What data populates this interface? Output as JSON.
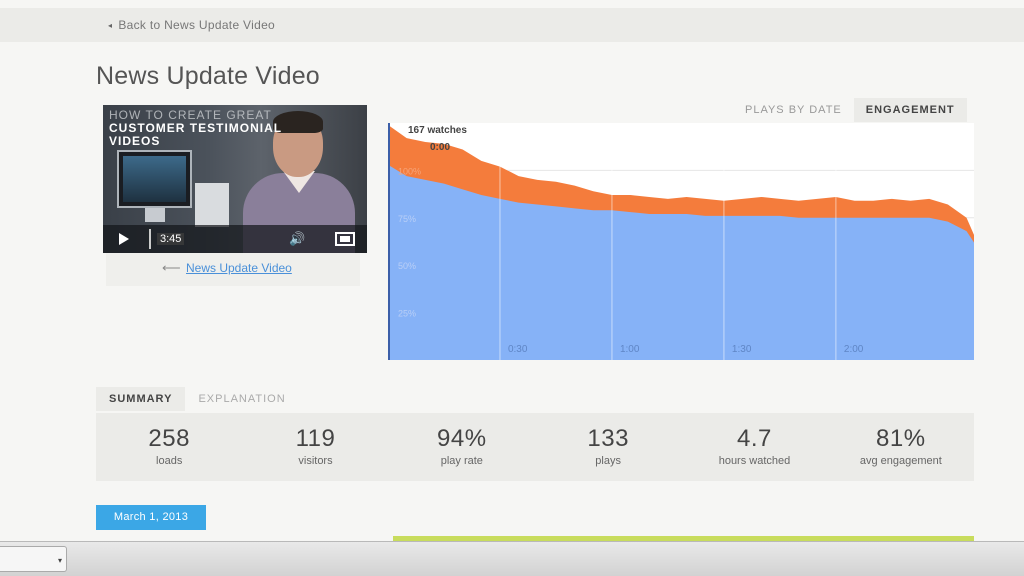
{
  "nav": {
    "back_label": "Back to News Update Video"
  },
  "page": {
    "title": "News Update Video"
  },
  "video": {
    "overlay_lines": [
      "How to create great",
      "Customer testimonial",
      "videos"
    ],
    "time": "3:45",
    "caption_link": "News Update Video"
  },
  "chart_tabs": [
    {
      "label": "PLAYS BY DATE",
      "active": false
    },
    {
      "label": "ENGAGEMENT",
      "active": true
    }
  ],
  "chart_data": {
    "type": "area",
    "title": "",
    "watches_label": "167 watches",
    "cursor_time": "0:00",
    "x_ticks": [
      "0:30",
      "1:00",
      "1:30",
      "2:00"
    ],
    "y_ticks": [
      "100%",
      "75%",
      "50%",
      "25%"
    ],
    "xlim": [
      0,
      157
    ],
    "ylim": [
      0,
      125
    ],
    "series": [
      {
        "x": [
          0,
          5,
          10,
          15,
          20,
          25,
          30,
          35,
          40,
          45,
          50,
          55,
          60,
          65,
          70,
          75,
          80,
          85,
          90,
          95,
          100,
          105,
          110,
          115,
          120,
          125,
          130,
          135,
          140,
          145,
          150,
          155,
          157
        ],
        "values": [
          124,
          117,
          115,
          114,
          111,
          105,
          102,
          97,
          95,
          94,
          92,
          89,
          87,
          87,
          86,
          85,
          86,
          85,
          84,
          85,
          86,
          85,
          84,
          85,
          86,
          84,
          84,
          85,
          84,
          85,
          82,
          75,
          66
        ],
        "color": "#f47c3c"
      },
      {
        "x": [
          0,
          5,
          10,
          15,
          20,
          25,
          30,
          35,
          40,
          45,
          50,
          55,
          60,
          65,
          70,
          75,
          80,
          85,
          90,
          95,
          100,
          105,
          110,
          115,
          120,
          125,
          130,
          135,
          140,
          145,
          150,
          155,
          157
        ],
        "values": [
          103,
          97,
          95,
          93,
          90,
          87,
          85,
          83,
          82,
          81,
          80,
          79,
          79,
          78,
          77,
          77,
          77,
          76,
          76,
          76,
          76,
          76,
          75,
          75,
          75,
          75,
          75,
          75,
          75,
          75,
          73,
          68,
          62
        ],
        "color": "#86b2f7"
      }
    ]
  },
  "summary_tabs": [
    {
      "label": "SUMMARY",
      "active": true
    },
    {
      "label": "EXPLANATION",
      "active": false
    }
  ],
  "stats": [
    {
      "value": "258",
      "label": "loads"
    },
    {
      "value": "119",
      "label": "visitors"
    },
    {
      "value": "94%",
      "label": "play rate"
    },
    {
      "value": "133",
      "label": "plays"
    },
    {
      "value": "4.7",
      "label": "hours watched"
    },
    {
      "value": "81%",
      "label": "avg engagement"
    }
  ],
  "date_badge": "March 1, 2013",
  "colors": {
    "orange": "#f47c3c",
    "blue": "#86b2f7",
    "badge": "#3ba7e6",
    "strip": "#c8dc5c"
  }
}
